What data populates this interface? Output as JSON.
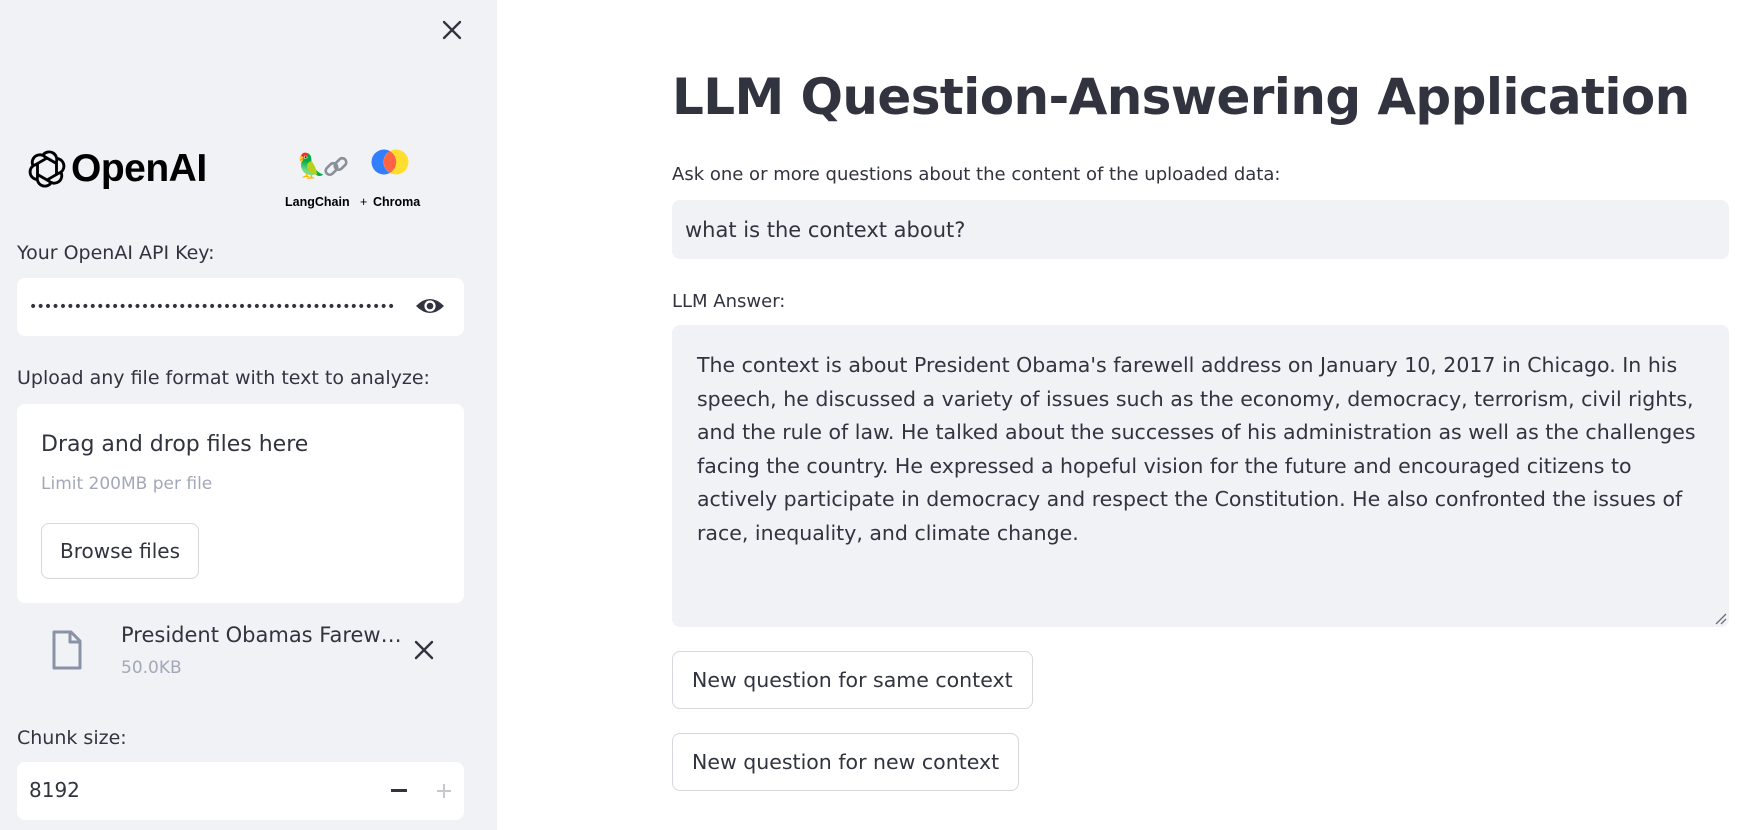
{
  "sidebar": {
    "logos": {
      "openai_wordmark": "OpenAI",
      "langchain_caption": "LangChain",
      "plus": "+",
      "chroma_caption": "Chroma"
    },
    "api_key": {
      "label": "Your OpenAI API Key:",
      "masked_value": "••••••••••••••••••••••••••••••••••••••••••••••••••••••••••••"
    },
    "uploader": {
      "label": "Upload any file format with text to analyze:",
      "drag_text": "Drag and drop files here",
      "limit_text": "Limit 200MB per file",
      "browse_label": "Browse files",
      "file": {
        "name": "President Obamas Farewell Address.txt",
        "size": "50.0KB"
      }
    },
    "chunk_size": {
      "label": "Chunk size:",
      "value": "8192"
    }
  },
  "main": {
    "title": "LLM Question-Answering Application",
    "question_label": "Ask one or more questions about the content of the uploaded data:",
    "question_value": "what is the context about?",
    "answer_label": "LLM Answer:",
    "answer_text": "The context is about President Obama's farewell address on January 10, 2017 in Chicago. In his speech, he discussed a variety of issues such as the economy, democracy, terrorism, civil rights, and the rule of law. He talked about the successes of his administration as well as the challenges facing the country. He expressed a hopeful vision for the future and encouraged citizens to actively participate in democracy and respect the Constitution. He also confronted the issues of race, inequality, and climate change.",
    "buttons": {
      "same_context": "New question for same context",
      "new_context": "New question for new context"
    }
  },
  "colors": {
    "sidebar_bg": "#f0f2f6",
    "text": "#31333f",
    "muted": "#a3a8b8",
    "border": "#d5d7dd",
    "chroma_blue": "#327eff",
    "chroma_orange": "#ff6446",
    "chroma_yellow": "#ffde2d"
  },
  "icons": {
    "close": "close-icon",
    "eye": "eye-icon",
    "file": "file-icon",
    "remove": "remove-file-icon",
    "minus": "minus-icon",
    "plus": "plus-icon",
    "openai": "openai-icon",
    "parrot": "parrot-emoji",
    "chain": "chain-link-emoji"
  }
}
